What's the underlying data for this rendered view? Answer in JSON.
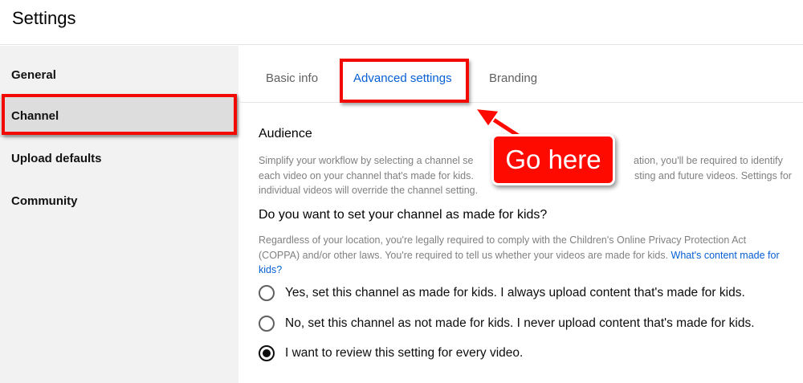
{
  "header": {
    "title": "Settings"
  },
  "sidebar": {
    "items": [
      {
        "label": "General",
        "active": false
      },
      {
        "label": "Channel",
        "active": true
      },
      {
        "label": "Upload defaults",
        "active": false
      },
      {
        "label": "Community",
        "active": false
      }
    ]
  },
  "tabs": [
    {
      "label": "Basic info",
      "active": false
    },
    {
      "label": "Advanced settings",
      "active": true
    },
    {
      "label": "Branding",
      "active": false
    }
  ],
  "audience": {
    "title": "Audience",
    "description_lines": [
      "Simplify your workflow by selecting a channel se",
      "ation, you'll be required to identify",
      "each video on your channel that's made for kids.",
      "sting and future videos. Settings for",
      "individual videos will override the channel setting."
    ],
    "question": "Do you want to set your channel as made for kids?",
    "legal_text": "Regardless of your location, you're legally required to comply with the Children's Online Privacy Protection Act (COPPA) and/or other laws. You're required to tell us whether your videos are made for kids.",
    "legal_link": "What's content made for kids?",
    "options": [
      {
        "label": "Yes, set this channel as made for kids. I always upload content that's made for kids.",
        "checked": false
      },
      {
        "label": "No, set this channel as not made for kids. I never upload content that's made for kids.",
        "checked": false
      },
      {
        "label": "I want to review this setting for every video.",
        "checked": true
      }
    ]
  },
  "annotation": {
    "text": "Go here",
    "color": "#ff0a00"
  },
  "colors": {
    "accent": "#065fd4",
    "highlight_red": "#f20a00"
  }
}
